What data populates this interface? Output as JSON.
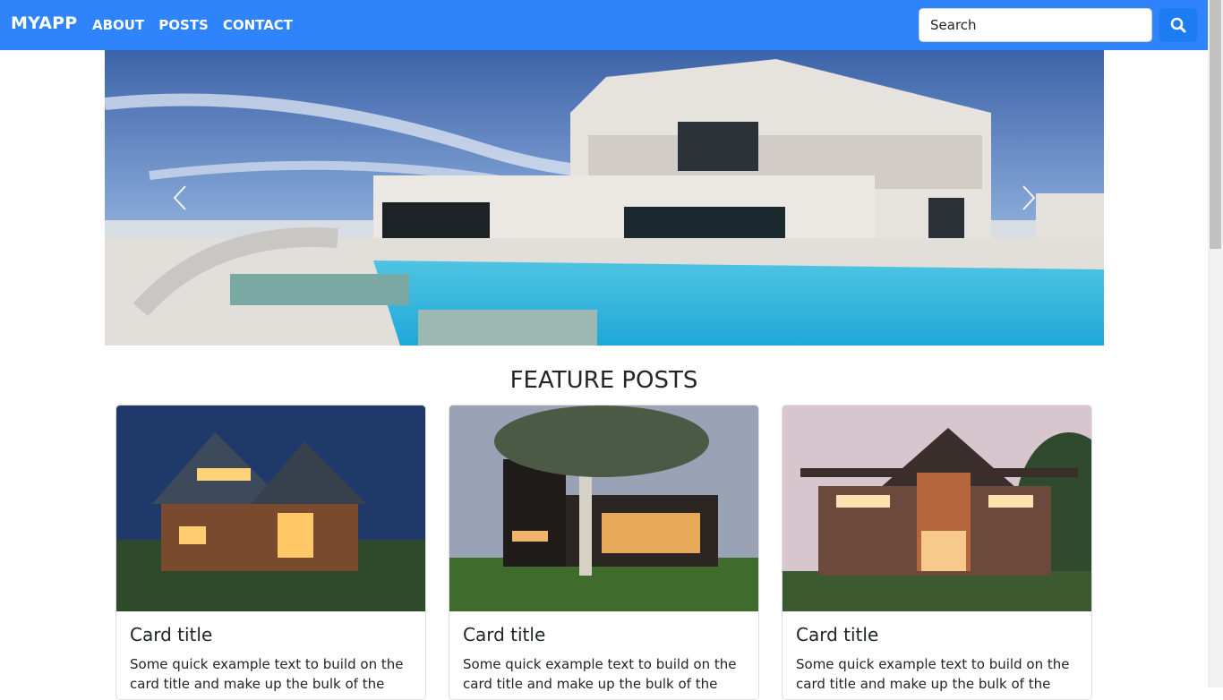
{
  "navbar": {
    "brand": "MYAPP",
    "links": [
      "ABOUT",
      "POSTS",
      "CONTACT"
    ],
    "search_placeholder": "Search",
    "search_icon": "search-icon",
    "background": "#2f83fb",
    "button_color": "#1c7cf4"
  },
  "carousel": {
    "prev_icon": "chevron-left-icon",
    "next_icon": "chevron-right-icon",
    "image": "modern white villa with swimming pool"
  },
  "main": {
    "section_title": "FEATURE POSTS",
    "cards": [
      {
        "title": "Card title",
        "text": "Some quick example text to build on the card title and make up the bulk of the",
        "image": "wooden house at dusk"
      },
      {
        "title": "Card title",
        "text": "Some quick example text to build on the card title and make up the bulk of the",
        "image": "modern house with tree"
      },
      {
        "title": "Card title",
        "text": "Some quick example text to build on the card title and make up the bulk of the",
        "image": "a-frame house at twilight"
      }
    ]
  }
}
